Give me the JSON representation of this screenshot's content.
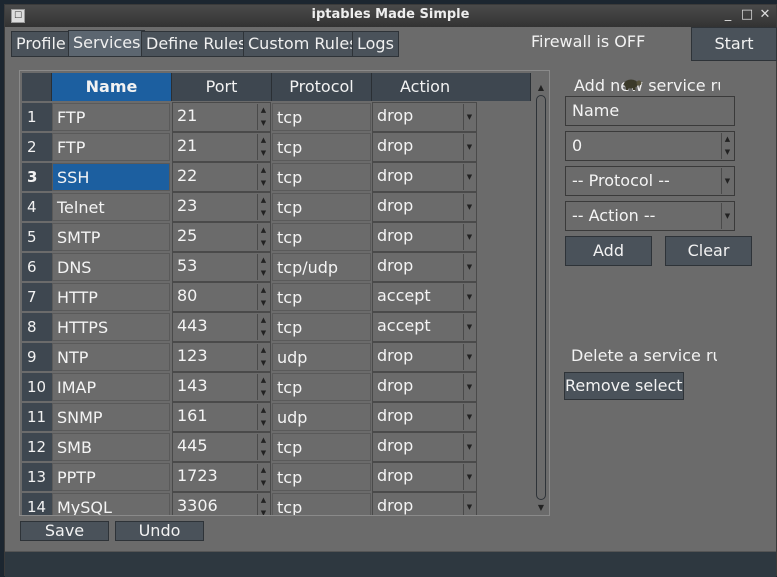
{
  "window": {
    "title": "iptables Made Simple"
  },
  "tabs": [
    {
      "label": "Profile"
    },
    {
      "label": "Services",
      "active": true
    },
    {
      "label": "Define Rules"
    },
    {
      "label": "Custom Rules"
    },
    {
      "label": "Logs"
    }
  ],
  "firewall_status": "Firewall is OFF",
  "start_label": "Start",
  "table": {
    "columns": [
      "Name",
      "Port",
      "Protocol",
      "Action"
    ],
    "sorted_column": "Name",
    "selected_row": 3,
    "rows": [
      {
        "num": "1",
        "name": "FTP",
        "port": "21",
        "protocol": "tcp",
        "action": "drop"
      },
      {
        "num": "2",
        "name": "FTP",
        "port": "21",
        "protocol": "tcp",
        "action": "drop"
      },
      {
        "num": "3",
        "name": "SSH",
        "port": "22",
        "protocol": "tcp",
        "action": "drop"
      },
      {
        "num": "4",
        "name": "Telnet",
        "port": "23",
        "protocol": "tcp",
        "action": "drop"
      },
      {
        "num": "5",
        "name": "SMTP",
        "port": "25",
        "protocol": "tcp",
        "action": "drop"
      },
      {
        "num": "6",
        "name": "DNS",
        "port": "53",
        "protocol": "tcp/udp",
        "action": "drop"
      },
      {
        "num": "7",
        "name": "HTTP",
        "port": "80",
        "protocol": "tcp",
        "action": "accept"
      },
      {
        "num": "8",
        "name": "HTTPS",
        "port": "443",
        "protocol": "tcp",
        "action": "accept"
      },
      {
        "num": "9",
        "name": "NTP",
        "port": "123",
        "protocol": "udp",
        "action": "drop"
      },
      {
        "num": "10",
        "name": "IMAP",
        "port": "143",
        "protocol": "tcp",
        "action": "drop"
      },
      {
        "num": "11",
        "name": "SNMP",
        "port": "161",
        "protocol": "udp",
        "action": "drop"
      },
      {
        "num": "12",
        "name": "SMB",
        "port": "445",
        "protocol": "tcp",
        "action": "drop"
      },
      {
        "num": "13",
        "name": "PPTP",
        "port": "1723",
        "protocol": "tcp",
        "action": "drop"
      },
      {
        "num": "14",
        "name": "MySQL",
        "port": "3306",
        "protocol": "tcp",
        "action": "drop"
      }
    ]
  },
  "save_label": "Save",
  "undo_label": "Undo",
  "add_panel": {
    "title": "Add new service rule",
    "name_value": "Name",
    "port_value": "0",
    "protocol_value": "-- Protocol --",
    "action_value": "-- Action --",
    "add_label": "Add",
    "clear_label": "Clear"
  },
  "delete_panel": {
    "title": "Delete a service rule",
    "remove_label": "Remove selected"
  },
  "colors": {
    "accent": "#1c5fa0",
    "background": "#6b6b6b",
    "header": "#3e4750"
  }
}
